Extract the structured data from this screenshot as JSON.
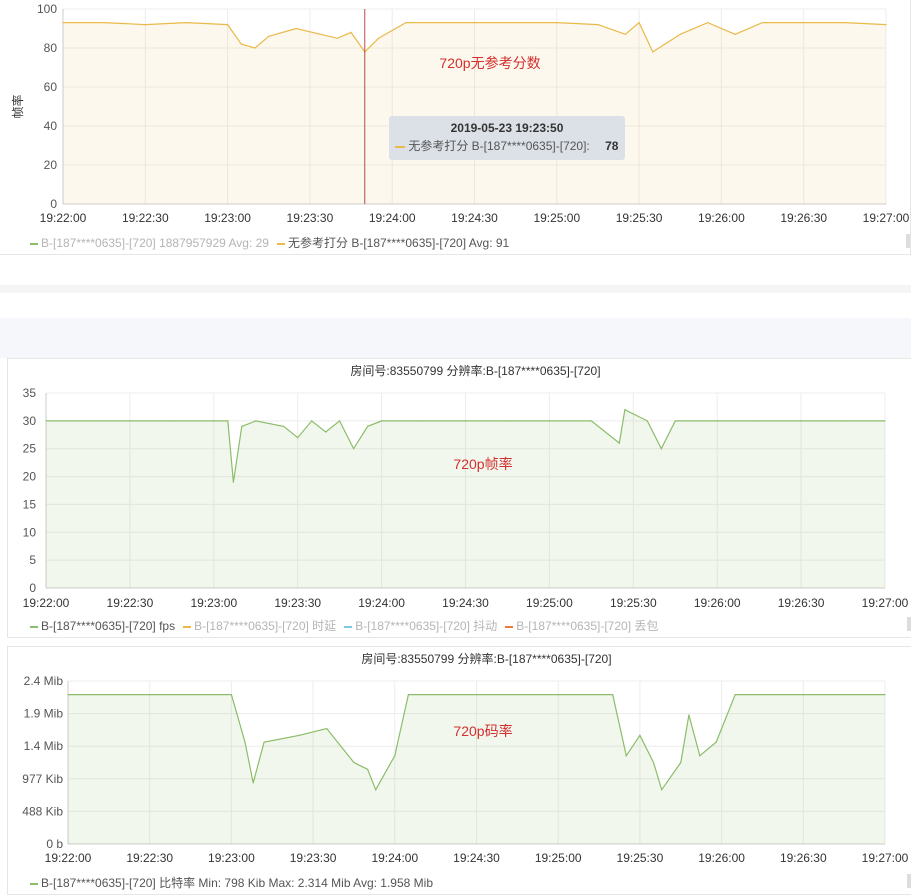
{
  "colors": {
    "green": "#8cbd6a",
    "yellow": "#e9b94a",
    "blue": "#7ec8e3",
    "orange": "#e87b3a",
    "annotation": "#d32f2f",
    "crosshair": "#b94a4a"
  },
  "time_ticks": [
    "19:22:00",
    "19:22:30",
    "19:23:00",
    "19:23:30",
    "19:24:00",
    "19:24:30",
    "19:25:00",
    "19:25:30",
    "19:26:00",
    "19:26:30",
    "19:27:00"
  ],
  "charts": [
    {
      "id": "score",
      "y_label": "帧率",
      "annotation": "720p无参考分数",
      "legend": [
        {
          "label": "B-[187****0635]-[720] 1887957929 Avg: 29",
          "color": "green",
          "dimmed": true
        },
        {
          "label": "无参考打分 B-[187****0635]-[720] Avg: 91",
          "color": "yellow",
          "dimmed": false
        }
      ],
      "tooltip": {
        "time": "2019-05-23 19:23:50",
        "series": "无参考打分 B-[187****0635]-[720]:",
        "value": "78"
      }
    },
    {
      "id": "fps",
      "title": "房间号:83550799 分辨率:B-[187****0635]-[720]",
      "annotation": "720p帧率",
      "legend": [
        {
          "label": "B-[187****0635]-[720] fps",
          "color": "green",
          "dimmed": false
        },
        {
          "label": "B-[187****0635]-[720] 时延",
          "color": "yellow",
          "dimmed": true
        },
        {
          "label": "B-[187****0635]-[720] 抖动",
          "color": "blue",
          "dimmed": true
        },
        {
          "label": "B-[187****0635]-[720] 丢包",
          "color": "orange",
          "dimmed": true
        }
      ]
    },
    {
      "id": "bitrate",
      "title": "房间号:83550799 分辨率:B-[187****0635]-[720]",
      "annotation": "720p码率",
      "legend": [
        {
          "label": "B-[187****0635]-[720] 比特率 Min: 798 Kib Max: 2.314 Mib Avg: 1.958 Mib",
          "color": "green",
          "dimmed": false
        }
      ]
    }
  ],
  "chart_data": [
    {
      "type": "area",
      "ylabel": "帧率",
      "ylim": [
        0,
        100
      ],
      "y_ticks": [
        "0",
        "20",
        "40",
        "60",
        "80",
        "100"
      ],
      "x_range": [
        "19:22:00",
        "19:27:00"
      ],
      "grid": true,
      "series": [
        {
          "name": "无参考打分 B-[187****0635]-[720]",
          "color": "yellow",
          "points": [
            [
              "19:22:00",
              93
            ],
            [
              "19:22:15",
              93
            ],
            [
              "19:22:30",
              92
            ],
            [
              "19:22:45",
              93
            ],
            [
              "19:23:00",
              92
            ],
            [
              "19:23:05",
              82
            ],
            [
              "19:23:10",
              80
            ],
            [
              "19:23:15",
              86
            ],
            [
              "19:23:25",
              90
            ],
            [
              "19:23:40",
              85
            ],
            [
              "19:23:45",
              88
            ],
            [
              "19:23:50",
              78
            ],
            [
              "19:23:55",
              85
            ],
            [
              "19:24:05",
              93
            ],
            [
              "19:24:30",
              93
            ],
            [
              "19:25:00",
              93
            ],
            [
              "19:25:15",
              92
            ],
            [
              "19:25:25",
              87
            ],
            [
              "19:25:30",
              93
            ],
            [
              "19:25:35",
              78
            ],
            [
              "19:25:45",
              87
            ],
            [
              "19:25:55",
              93
            ],
            [
              "19:26:05",
              87
            ],
            [
              "19:26:15",
              93
            ],
            [
              "19:26:30",
              93
            ],
            [
              "19:26:45",
              93
            ],
            [
              "19:27:00",
              92
            ]
          ]
        }
      ]
    },
    {
      "type": "area",
      "title": "房间号:83550799 分辨率:B-[187****0635]-[720]",
      "ylim": [
        0,
        35
      ],
      "y_ticks": [
        "0",
        "5",
        "10",
        "15",
        "20",
        "25",
        "30",
        "35"
      ],
      "x_range": [
        "19:22:00",
        "19:27:00"
      ],
      "grid": true,
      "series": [
        {
          "name": "B-[187****0635]-[720] fps",
          "color": "green",
          "points": [
            [
              "19:22:00",
              30
            ],
            [
              "19:22:15",
              30
            ],
            [
              "19:22:30",
              30
            ],
            [
              "19:22:45",
              30
            ],
            [
              "19:23:00",
              30
            ],
            [
              "19:23:05",
              30
            ],
            [
              "19:23:07",
              19
            ],
            [
              "19:23:10",
              29
            ],
            [
              "19:23:15",
              30
            ],
            [
              "19:23:25",
              29
            ],
            [
              "19:23:30",
              27
            ],
            [
              "19:23:35",
              30
            ],
            [
              "19:23:40",
              28
            ],
            [
              "19:23:45",
              30
            ],
            [
              "19:23:50",
              25
            ],
            [
              "19:23:55",
              29
            ],
            [
              "19:24:00",
              30
            ],
            [
              "19:24:15",
              30
            ],
            [
              "19:24:30",
              30
            ],
            [
              "19:24:45",
              30
            ],
            [
              "19:25:00",
              30
            ],
            [
              "19:25:15",
              30
            ],
            [
              "19:25:25",
              26
            ],
            [
              "19:25:27",
              32
            ],
            [
              "19:25:35",
              30
            ],
            [
              "19:25:40",
              25
            ],
            [
              "19:25:45",
              30
            ],
            [
              "19:26:00",
              30
            ],
            [
              "19:26:15",
              30
            ],
            [
              "19:26:30",
              30
            ],
            [
              "19:26:45",
              30
            ],
            [
              "19:27:00",
              30
            ]
          ]
        },
        {
          "name": "B-[187****0635]-[720] 时延",
          "color": "yellow",
          "points": []
        },
        {
          "name": "B-[187****0635]-[720] 抖动",
          "color": "blue",
          "points": []
        },
        {
          "name": "B-[187****0635]-[720] 丢包",
          "color": "orange",
          "points": []
        }
      ]
    },
    {
      "type": "area",
      "title": "房间号:83550799 分辨率:B-[187****0635]-[720]",
      "ylim": [
        0,
        2.4
      ],
      "y_ticks": [
        "0 b",
        "488 Kib",
        "977 Kib",
        "1.4 Mib",
        "1.9 Mib",
        "2.4 Mib"
      ],
      "x_range": [
        "19:22:00",
        "19:27:00"
      ],
      "grid": true,
      "series": [
        {
          "name": "B-[187****0635]-[720] 比特率",
          "color": "green",
          "points": [
            [
              "19:22:00",
              2.2
            ],
            [
              "19:22:30",
              2.2
            ],
            [
              "19:23:00",
              2.2
            ],
            [
              "19:23:05",
              1.5
            ],
            [
              "19:23:08",
              0.9
            ],
            [
              "19:23:12",
              1.5
            ],
            [
              "19:23:25",
              1.6
            ],
            [
              "19:23:35",
              1.7
            ],
            [
              "19:23:45",
              1.2
            ],
            [
              "19:23:50",
              1.1
            ],
            [
              "19:23:53",
              0.8
            ],
            [
              "19:24:00",
              1.3
            ],
            [
              "19:24:05",
              2.2
            ],
            [
              "19:24:30",
              2.2
            ],
            [
              "19:25:00",
              2.2
            ],
            [
              "19:25:20",
              2.2
            ],
            [
              "19:25:25",
              1.3
            ],
            [
              "19:25:30",
              1.6
            ],
            [
              "19:25:35",
              1.2
            ],
            [
              "19:25:38",
              0.8
            ],
            [
              "19:25:45",
              1.2
            ],
            [
              "19:25:48",
              1.9
            ],
            [
              "19:25:52",
              1.3
            ],
            [
              "19:25:58",
              1.5
            ],
            [
              "19:26:05",
              2.2
            ],
            [
              "19:26:30",
              2.2
            ],
            [
              "19:27:00",
              2.2
            ]
          ]
        }
      ]
    }
  ]
}
